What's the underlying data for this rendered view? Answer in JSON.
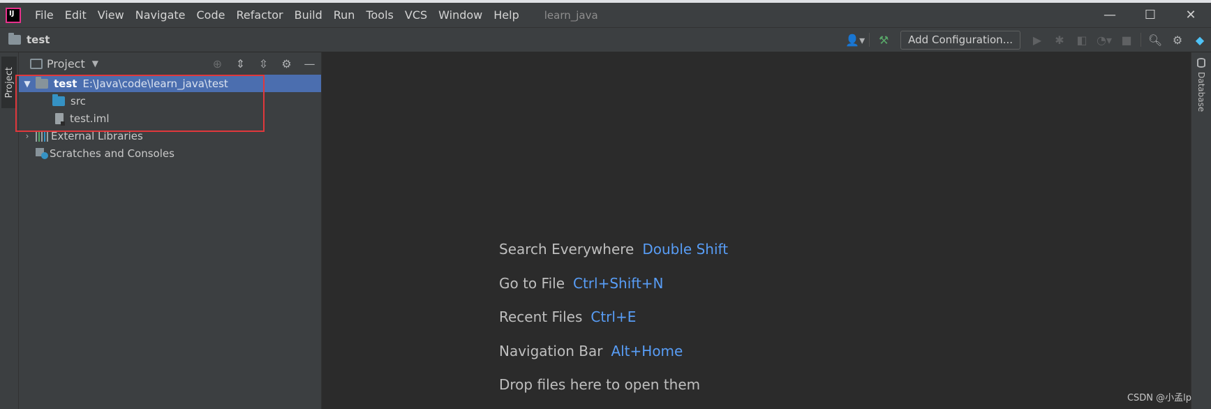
{
  "window": {
    "title": "learn_java",
    "app_logo_text": "IJ",
    "menu": [
      {
        "label": "File"
      },
      {
        "label": "Edit"
      },
      {
        "label": "View"
      },
      {
        "label": "Navigate"
      },
      {
        "label": "Code"
      },
      {
        "label": "Refactor"
      },
      {
        "label": "Build"
      },
      {
        "label": "Run"
      },
      {
        "label": "Tools"
      },
      {
        "label": "VCS"
      },
      {
        "label": "Window"
      },
      {
        "label": "Help"
      }
    ],
    "controls": {
      "minimize": "—",
      "maximize": "☐",
      "close": "✕"
    }
  },
  "toolbar": {
    "project_name": "test",
    "add_configuration_label": "Add Configuration...",
    "icons": [
      "user-icon",
      "build-hammer-icon",
      "run-icon",
      "debug-icon",
      "coverage-icon",
      "profile-icon",
      "stop-icon",
      "search-icon",
      "settings-icon",
      "logo-icon"
    ]
  },
  "left_stripe": {
    "project_tab_label": "Project"
  },
  "right_stripe": {
    "database_tab_label": "Database"
  },
  "project_panel": {
    "header_label": "Project",
    "tree": {
      "root_name": "test",
      "root_path": "E:\\Java\\code\\learn_java\\test",
      "src_label": "src",
      "iml_label": "test.iml",
      "external_libraries_label": "External Libraries",
      "scratches_label": "Scratches and Consoles"
    }
  },
  "editor": {
    "hints": [
      {
        "label": "Search Everywhere",
        "shortcut": "Double Shift"
      },
      {
        "label": "Go to File",
        "shortcut": "Ctrl+Shift+N"
      },
      {
        "label": "Recent Files",
        "shortcut": "Ctrl+E"
      },
      {
        "label": "Navigation Bar",
        "shortcut": "Alt+Home"
      },
      {
        "label": "Drop files here to open them",
        "shortcut": ""
      }
    ]
  },
  "watermark": "CSDN @小孟lp",
  "colors": {
    "selection": "#4b6eaf",
    "shortcut": "#589df6",
    "highlight_box": "#e0383c"
  }
}
